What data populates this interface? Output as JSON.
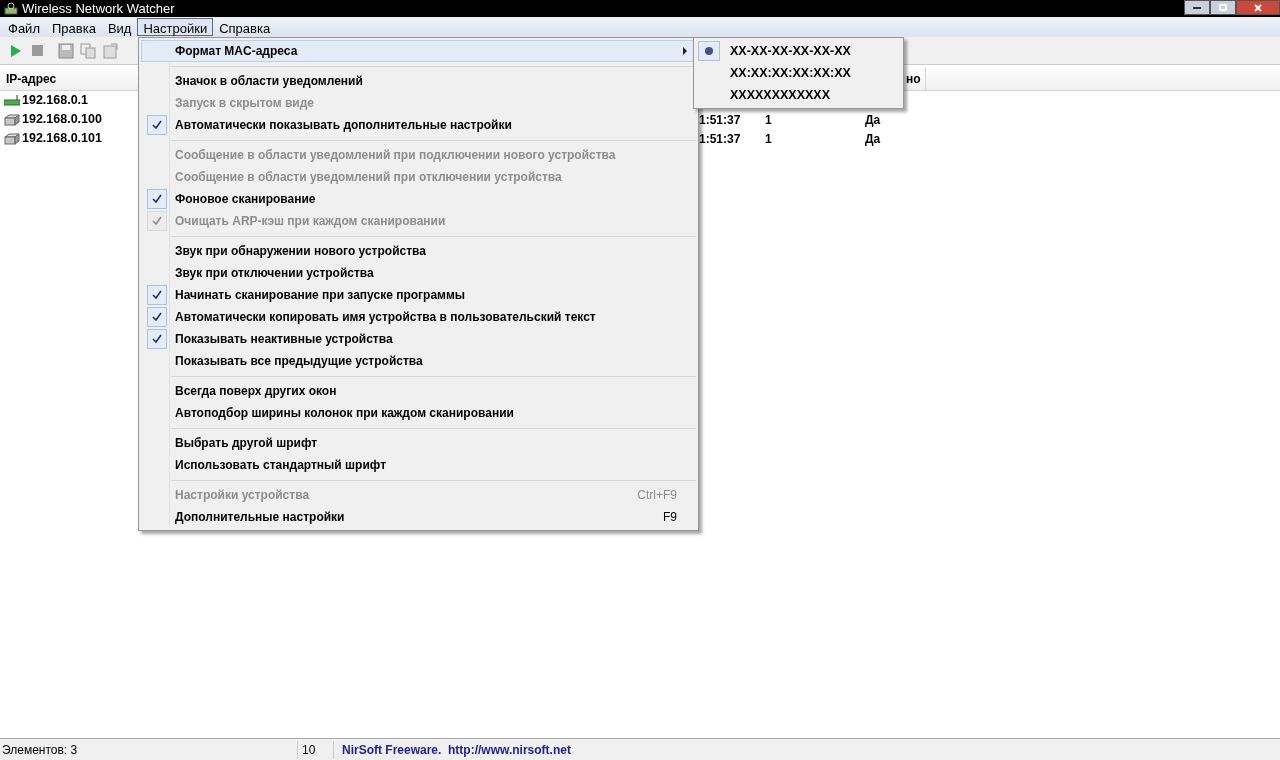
{
  "window": {
    "title": "Wireless Network Watcher"
  },
  "menubar": [
    {
      "label": "Файл",
      "selected": false
    },
    {
      "label": "Правка",
      "selected": false
    },
    {
      "label": "Вид",
      "selected": false
    },
    {
      "label": "Настройки",
      "selected": true
    },
    {
      "label": "Справка",
      "selected": false
    }
  ],
  "table": {
    "columns": [
      {
        "label": "IP-адрес"
      },
      {
        "label": "но"
      }
    ],
    "rows": [
      {
        "ip": "192.168.0.1",
        "kind": "router",
        "cells": []
      },
      {
        "ip": "192.168.0.100",
        "kind": "device",
        "cells": [
          "1:51:37",
          "1",
          "Да"
        ]
      },
      {
        "ip": "192.168.0.101",
        "kind": "device",
        "cells": [
          "1:51:37",
          "1",
          "Да"
        ]
      }
    ]
  },
  "menu": [
    {
      "kind": "submenu",
      "label": "Формат MAC-адреса",
      "checked": false,
      "disabled": false,
      "selected": true
    },
    {
      "kind": "separator"
    },
    {
      "kind": "item",
      "label": "Значок в области уведомлений",
      "checked": false,
      "disabled": false
    },
    {
      "kind": "item",
      "label": "Запуск в скрытом виде",
      "checked": false,
      "disabled": true
    },
    {
      "kind": "item",
      "label": "Автоматически показывать дополнительные настройки",
      "checked": true,
      "disabled": false
    },
    {
      "kind": "separator"
    },
    {
      "kind": "item",
      "label": "Сообщение в области уведомлений при подключении нового устройства",
      "checked": false,
      "disabled": true
    },
    {
      "kind": "item",
      "label": "Сообщение в области уведомлений при отключении устройства",
      "checked": false,
      "disabled": true
    },
    {
      "kind": "item",
      "label": "Фоновое сканирование",
      "checked": true,
      "disabled": false
    },
    {
      "kind": "item",
      "label": "Очищать ARP-кэш при каждом сканировании",
      "checked": true,
      "disabled": true
    },
    {
      "kind": "separator"
    },
    {
      "kind": "item",
      "label": "Звук при обнаружении нового устройства",
      "checked": false,
      "disabled": false
    },
    {
      "kind": "item",
      "label": "Звук при отключении устройства",
      "checked": false,
      "disabled": false
    },
    {
      "kind": "item",
      "label": "Начинать сканирование при запуске программы",
      "checked": true,
      "disabled": false
    },
    {
      "kind": "item",
      "label": "Автоматически копировать имя устройства в пользовательский текст",
      "checked": true,
      "disabled": false
    },
    {
      "kind": "item",
      "label": "Показывать неактивные устройства",
      "checked": true,
      "disabled": false
    },
    {
      "kind": "item",
      "label": "Показывать все предыдущие устройства",
      "checked": false,
      "disabled": false
    },
    {
      "kind": "separator"
    },
    {
      "kind": "item",
      "label": "Всегда поверх других окон",
      "checked": false,
      "disabled": false
    },
    {
      "kind": "item",
      "label": "Автоподбор ширины колонок при каждом сканировании",
      "checked": false,
      "disabled": false
    },
    {
      "kind": "separator"
    },
    {
      "kind": "item",
      "label": "Выбрать другой шрифт",
      "checked": false,
      "disabled": false
    },
    {
      "kind": "item",
      "label": "Использовать стандартный шрифт",
      "checked": false,
      "disabled": false
    },
    {
      "kind": "separator"
    },
    {
      "kind": "item",
      "label": "Настройки устройства",
      "shortcut": "Ctrl+F9",
      "checked": false,
      "disabled": true
    },
    {
      "kind": "item",
      "label": "Дополнительные настройки",
      "shortcut": "F9",
      "checked": false,
      "disabled": false
    }
  ],
  "submenu": [
    {
      "label": "XX-XX-XX-XX-XX-XX",
      "selected": true
    },
    {
      "label": "XX:XX:XX:XX:XX:XX",
      "selected": false
    },
    {
      "label": "XXXXXXXXXXXX",
      "selected": false
    }
  ],
  "status_bar": {
    "items": "Элементов: 3",
    "value": "10",
    "credit": "NirSoft Freeware.  http://www.nirsoft.net"
  }
}
